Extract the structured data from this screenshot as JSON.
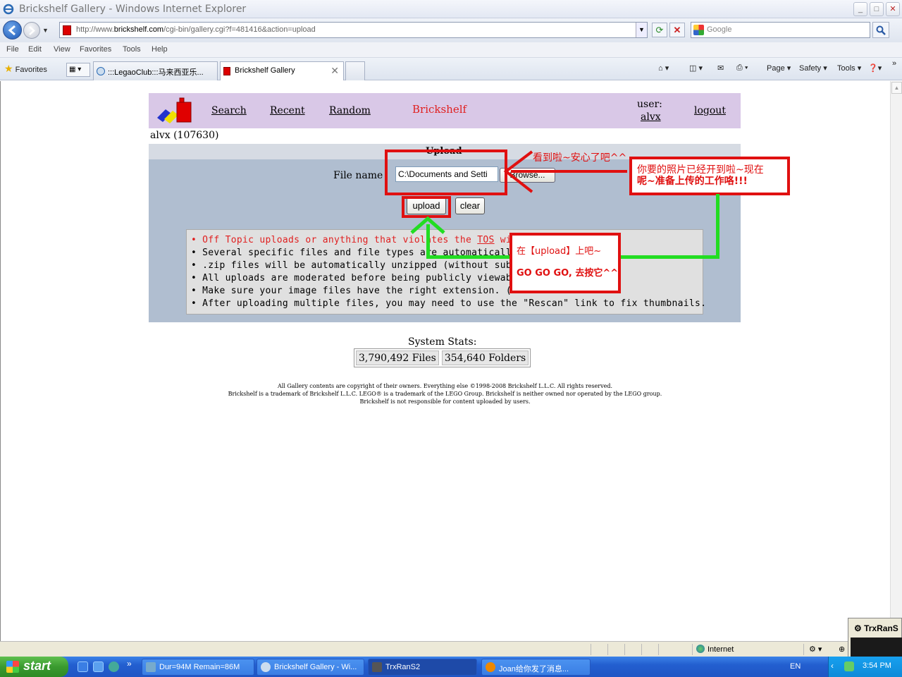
{
  "window": {
    "title": "Brickshelf Gallery - Windows Internet Explorer"
  },
  "address": {
    "prefix": "http://www.",
    "host": "brickshelf.com",
    "path": "/cgi-bin/gallery.cgi?f=481416&action=upload"
  },
  "search": {
    "placeholder": "Google"
  },
  "menu": [
    "File",
    "Edit",
    "View",
    "Favorites",
    "Tools",
    "Help"
  ],
  "tabs": {
    "favorites": "Favorites",
    "items": [
      ":::LegaoClub:::马来西亚乐...",
      "Brickshelf Gallery"
    ]
  },
  "commands": {
    "page": "Page",
    "safety": "Safety",
    "tools": "Tools"
  },
  "site": {
    "nav": [
      "Search",
      "Recent",
      "Random"
    ],
    "brand": "Brickshelf",
    "user_label": "user:",
    "user_name": "alvx",
    "logout": "logout",
    "account": "alvx (107630)"
  },
  "upload_form": {
    "title": "Upload",
    "file_label": "File name",
    "file_value": "C:\\Documents and Setti",
    "browse": "Browse...",
    "upload": "upload",
    "clear": "clear"
  },
  "rules": {
    "r1_pre": "Off Topic uploads or anything that violates the ",
    "r1_tos": "TOS",
    "r1_post": " wil",
    "r2": "Several specific files and file types are automatically                  .html, .exe ...)",
    "r3": ".zip files will be automatically unzipped (without sub-",
    "r4": "All uploads are moderated before being publicly viewab                   immediately",
    "r5": "Make sure your image files have the right extension.  (.",
    "r6": "After uploading multiple files, you may need to use the \"Rescan\" link to fix thumbnails."
  },
  "stats": {
    "title": "System Stats:",
    "files": "3,790,492 Files",
    "folders": "354,640 Folders"
  },
  "footer": {
    "line1": "All Gallery contents are copyright of their owners. Everything else ©1998-2008 Brickshelf L.L.C. All rights reserved.",
    "line2": "Brickshelf is a trademark of Brickshelf L.L.C. LEGO® is a trademark of the LEGO Group. Brickshelf is neither owned nor operated by the LEGO group.",
    "line3": "Brickshelf is not responsible for content uploaded by users."
  },
  "annotations": {
    "seen": "看到啦~安心了吧^^",
    "opened_line1": "你要的照片已经开到啦~现在",
    "opened_line2": "呢~准备上传的工作咯!!!",
    "click_line1": "在【upload】上吧~",
    "click_line2": "GO GO GO, 去按它^^"
  },
  "statusbar": {
    "zone": "Internet"
  },
  "popup": {
    "title": "TrxRanS"
  },
  "taskbar": {
    "start": "start",
    "tasks": [
      "Dur=94M Remain=86M",
      "Brickshelf Gallery - Wi...",
      "TrxRanS2",
      "Joan给你发了消息..."
    ],
    "lang": "EN",
    "clock": "3:54 PM"
  },
  "colors": {
    "accent_red": "#e01010",
    "arrow_green": "#22dd22",
    "header_purple": "#d9c8e7",
    "panel_blue": "#b0bed0"
  }
}
